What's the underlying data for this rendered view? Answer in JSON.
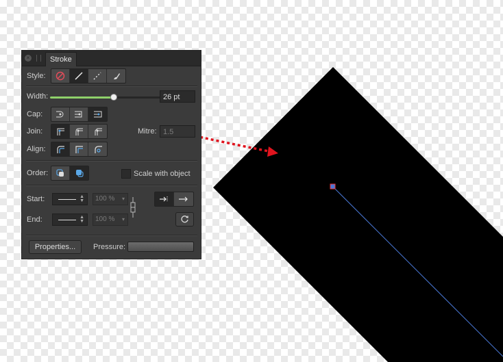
{
  "panel": {
    "tab_title": "Stroke",
    "style": {
      "label": "Style:",
      "options": [
        "no-stroke-icon",
        "solid-line-icon",
        "dashed-line-icon",
        "brush-icon"
      ]
    },
    "width": {
      "label": "Width:",
      "value": "26 pt",
      "slider_fraction": 0.5
    },
    "cap": {
      "label": "Cap:",
      "options": [
        "butt-cap-icon",
        "round-cap-icon",
        "square-cap-icon"
      ],
      "selected": 2
    },
    "join": {
      "label": "Join:",
      "options": [
        "miter-join-icon",
        "round-join-icon",
        "bevel-join-icon"
      ]
    },
    "mitre": {
      "label": "Mitre:",
      "value": "1.5"
    },
    "align": {
      "label": "Align:",
      "options": [
        "align-center-icon",
        "align-inside-icon",
        "align-outside-icon"
      ]
    },
    "order": {
      "label": "Order:",
      "options": [
        "stroke-behind-fill-icon",
        "stroke-in-front-icon"
      ]
    },
    "scale_with_object": {
      "label": "Scale with object",
      "checked": false
    },
    "start": {
      "label": "Start:",
      "percent": "100 %"
    },
    "end": {
      "label": "End:",
      "percent": "100 %"
    },
    "properties_button": "Properties...",
    "pressure_label": "Pressure:"
  },
  "colors": {
    "panel_bg": "#3b3b3b",
    "slider_fill": "#8fd16a",
    "arrow": "#e0141e",
    "shape_fill": "#000000",
    "path_line": "#4a78d6",
    "node": "#4a78d6"
  }
}
